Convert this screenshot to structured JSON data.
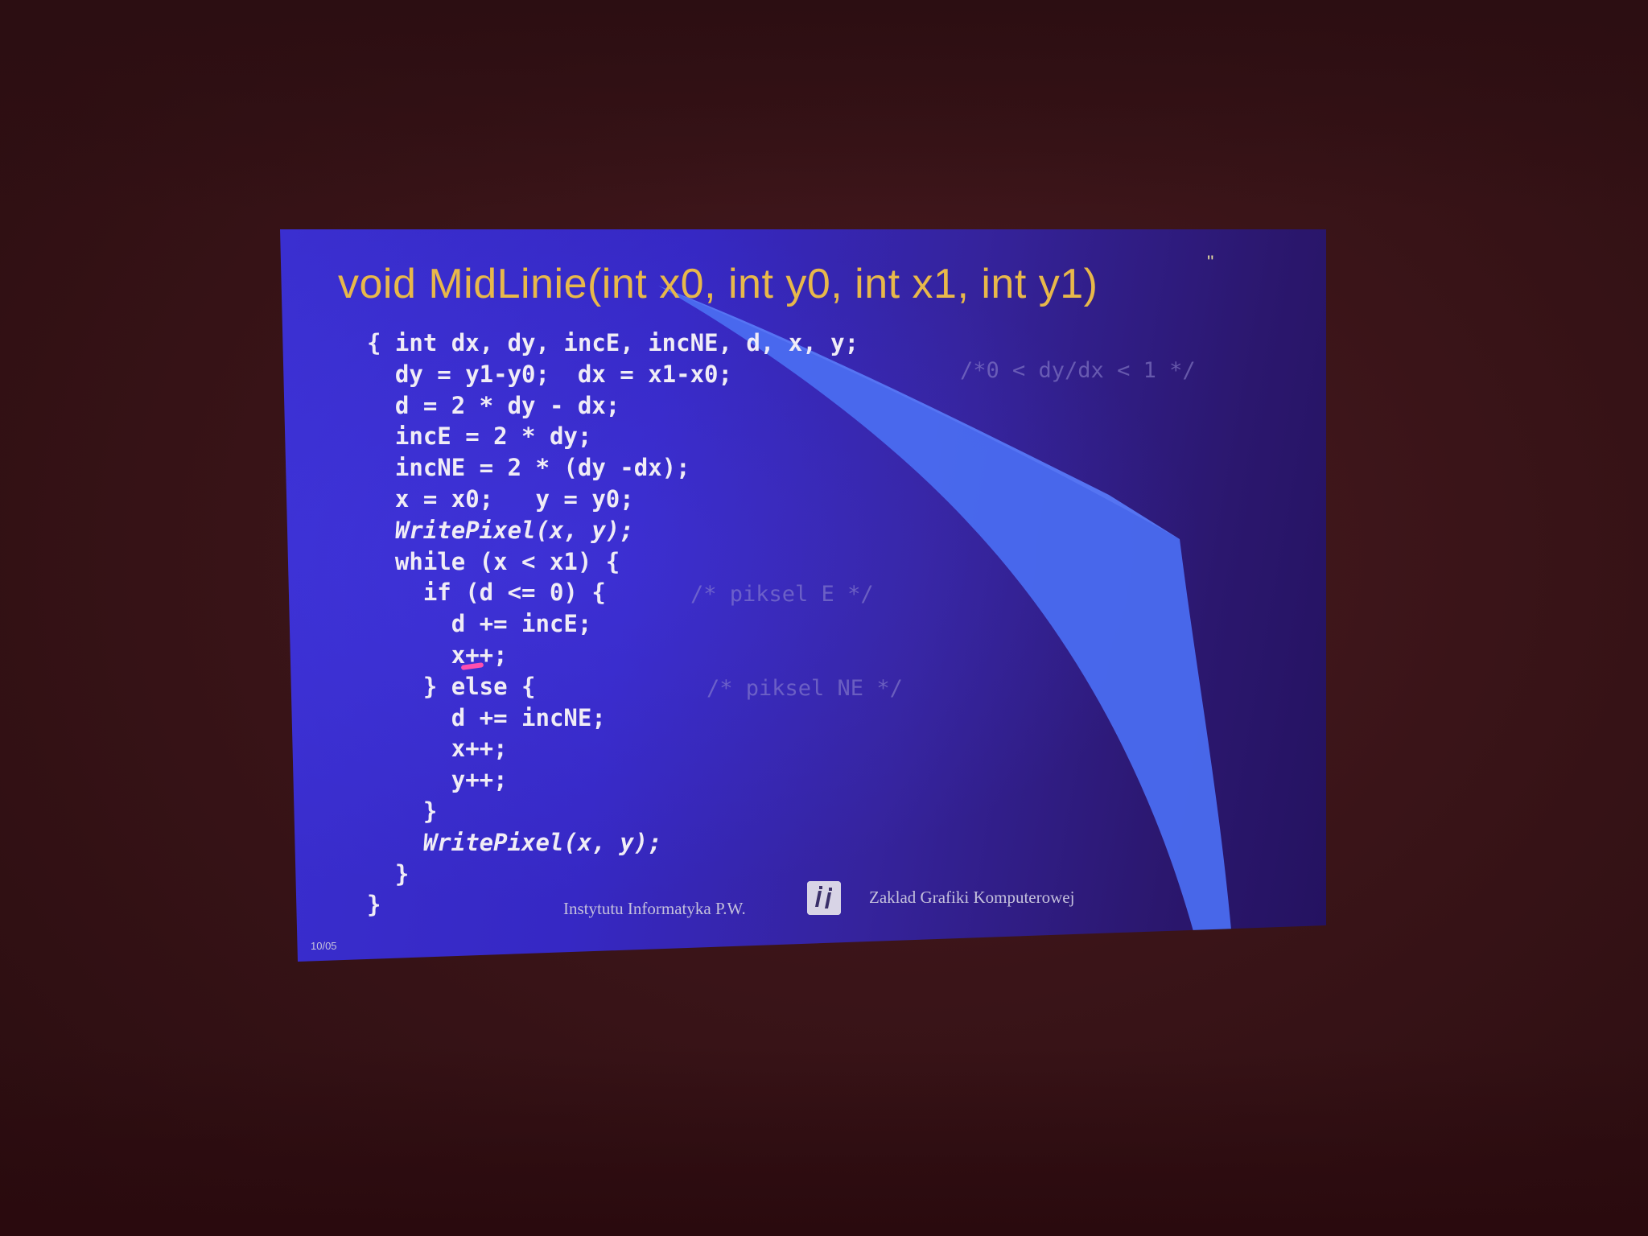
{
  "slide": {
    "title": "void MidLinie(int x0, int y0, int x1, int y1)",
    "title_mark": "''",
    "code_lines": [
      "{ int dx, dy, incE, incNE, d, x, y;",
      "  dy = y1-y0;  dx = x1-x0;",
      "  d = 2 * dy - dx;",
      "  incE = 2 * dy;",
      "  incNE = 2 * (dy -dx);",
      "  x = x0;   y = y0;",
      "  WritePixel(x, y);",
      "  while (x < x1) {",
      "    if (d <= 0) {",
      "      d += incE;",
      "      x++;",
      "    } else {",
      "      d += incNE;",
      "      x++;",
      "      y++;",
      "    }",
      "    WritePixel(x, y);",
      "  }",
      "}"
    ],
    "comments": {
      "slope": "/*0 < dy/dx < 1 */",
      "pixel_e": "/* piksel E */",
      "pixel_ne": "/* piksel NE */"
    },
    "footer": {
      "left": "Instytutu Informatyka P.W.",
      "right": "Zaklad Grafiki Komputerowej",
      "page": "10/05"
    }
  },
  "colors": {
    "title": "#e8b84a",
    "code": "#f0ecf6",
    "slide_background": "#3a2fd0",
    "swoosh": "#4a6cf0",
    "room": "#3a1418"
  }
}
